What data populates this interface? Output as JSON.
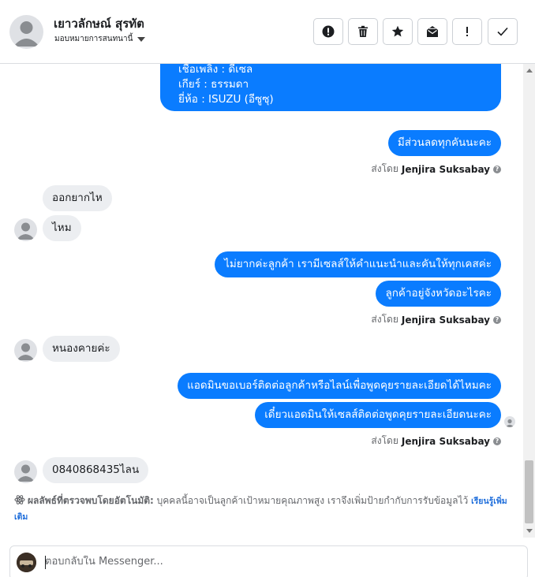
{
  "header": {
    "customer_name": "เยาวลักษณ์ สุรทัต",
    "assign_label": "มอบหมายการสนทนานี้",
    "actions": [
      "alert-circle-icon",
      "trash-icon",
      "star-icon",
      "mark-unread-icon",
      "exclamation-icon",
      "check-icon"
    ]
  },
  "messages": {
    "vehicle_info": {
      "fuel": "เชื้อเพลิง : ดีเซล",
      "gear": "เกียร์ : ธรรมดา",
      "brand": "ยี่ห้อ : ISUZU (อีซูซุ)"
    },
    "m1": "มีส่วนลดทุกคันนะคะ",
    "m2": "ออกยากไห",
    "m3": "ไหม",
    "m4": "ไม่ยากค่ะลูกค้า เรามีเซลส์ให้คำแนะนำและคันให้ทุกเคสค่ะ",
    "m5": "ลูกค้าอยู่จังหวัดอะไรคะ",
    "m6": "หนองคายค่ะ",
    "m7": "แอดมินขอเบอร์ติดต่อลูกค้าหรือไลน์เพื่อพูดคุยรายละเอียดได้ไหมคะ",
    "m8": "เดี๋ยวแอดมินให้เซลส์ติดต่อพูดคุยรายละเอียดนะคะ",
    "m9": "0840868435ไลน"
  },
  "sent_by": {
    "prefix": "ส่งโดย",
    "agent": "Jenjira Suksabay"
  },
  "ai_note": {
    "title": "ผลลัพธ์ที่ตรวจพบโดยอัตโนมัติ:",
    "body": " บุคคลนี้อาจเป็นลูกค้าเป้าหมายคุณภาพสูง เราจึงเพิ่มป้ายกำกับการรับข้อมูลไว้ ",
    "link": "เรียนรู้เพิ่มเติม"
  },
  "composer": {
    "placeholder": "ตอบกลับใน Messenger..."
  },
  "colors": {
    "outgoing": "#0a7cff",
    "incoming": "#eceef1",
    "link": "#216fdb"
  }
}
